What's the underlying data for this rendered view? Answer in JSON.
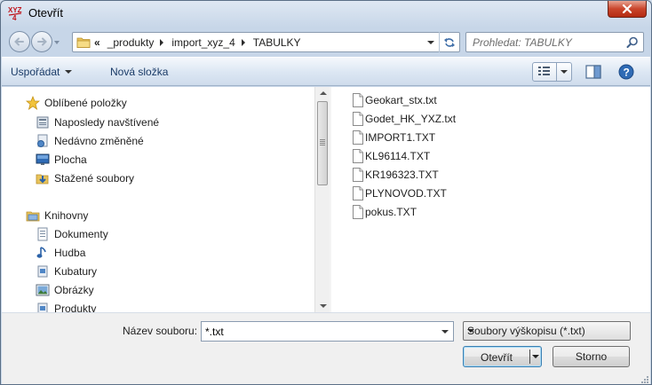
{
  "window": {
    "title": "Otevřít",
    "app_icon_text": "XYZ"
  },
  "address": {
    "overflow": "«",
    "crumbs": [
      "_produkty",
      "import_xyz_4",
      "TABULKY"
    ]
  },
  "search": {
    "placeholder": "Prohledat: TABULKY"
  },
  "toolbar": {
    "organize_label": "Uspořádat",
    "new_folder_label": "Nová složka"
  },
  "nav": {
    "favorites_header": "Oblíbené položky",
    "favorites": [
      {
        "label": "Naposledy navštívené",
        "icon": "recent-places-icon"
      },
      {
        "label": "Nedávno změněné",
        "icon": "recent-changes-icon"
      },
      {
        "label": "Plocha",
        "icon": "desktop-icon"
      },
      {
        "label": "Stažené soubory",
        "icon": "downloads-icon"
      }
    ],
    "libraries_header": "Knihovny",
    "libraries": [
      {
        "label": "Dokumenty",
        "icon": "documents-icon"
      },
      {
        "label": "Hudba",
        "icon": "music-icon"
      },
      {
        "label": "Kubatury",
        "icon": "library-icon"
      },
      {
        "label": "Obrázky",
        "icon": "pictures-icon"
      },
      {
        "label": "Produkty",
        "icon": "library-icon"
      }
    ]
  },
  "files": [
    "Geokart_stx.txt",
    "Godet_HK_YXZ.txt",
    "IMPORT1.TXT",
    "KL96114.TXT",
    "KR196323.TXT",
    "PLYNOVOD.TXT",
    "pokus.TXT"
  ],
  "footer": {
    "filename_label": "Název souboru:",
    "filename_value": "*.txt",
    "filetype_value": "Soubory výškopisu (*.txt)",
    "open_label": "Otevřít",
    "cancel_label": "Storno"
  },
  "colors": {
    "accent": "#1a3b67",
    "close": "#c9452b"
  }
}
